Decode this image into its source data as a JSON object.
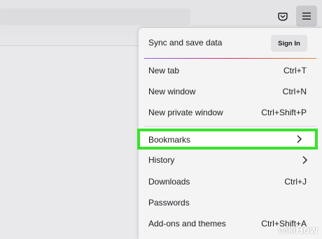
{
  "toolbar": {
    "pocket_icon": "pocket-icon",
    "menu_icon": "hamburger-menu-icon"
  },
  "menu": {
    "sync_label": "Sync and save data",
    "sign_in_label": "Sign In",
    "items": [
      {
        "label": "New tab",
        "shortcut": "Ctrl+T"
      },
      {
        "label": "New window",
        "shortcut": "Ctrl+N"
      },
      {
        "label": "New private window",
        "shortcut": "Ctrl+Shift+P"
      },
      {
        "label": "Bookmarks",
        "shortcut": "",
        "submenu": true
      },
      {
        "label": "History",
        "shortcut": "",
        "submenu": true
      },
      {
        "label": "Downloads",
        "shortcut": "Ctrl+J"
      },
      {
        "label": "Passwords",
        "shortcut": ""
      },
      {
        "label": "Add-ons and themes",
        "shortcut": "Ctrl+Shift+A"
      }
    ]
  },
  "highlight_color": "#37e32a",
  "watermark": {
    "wiki": "wiki",
    "how": "How"
  }
}
